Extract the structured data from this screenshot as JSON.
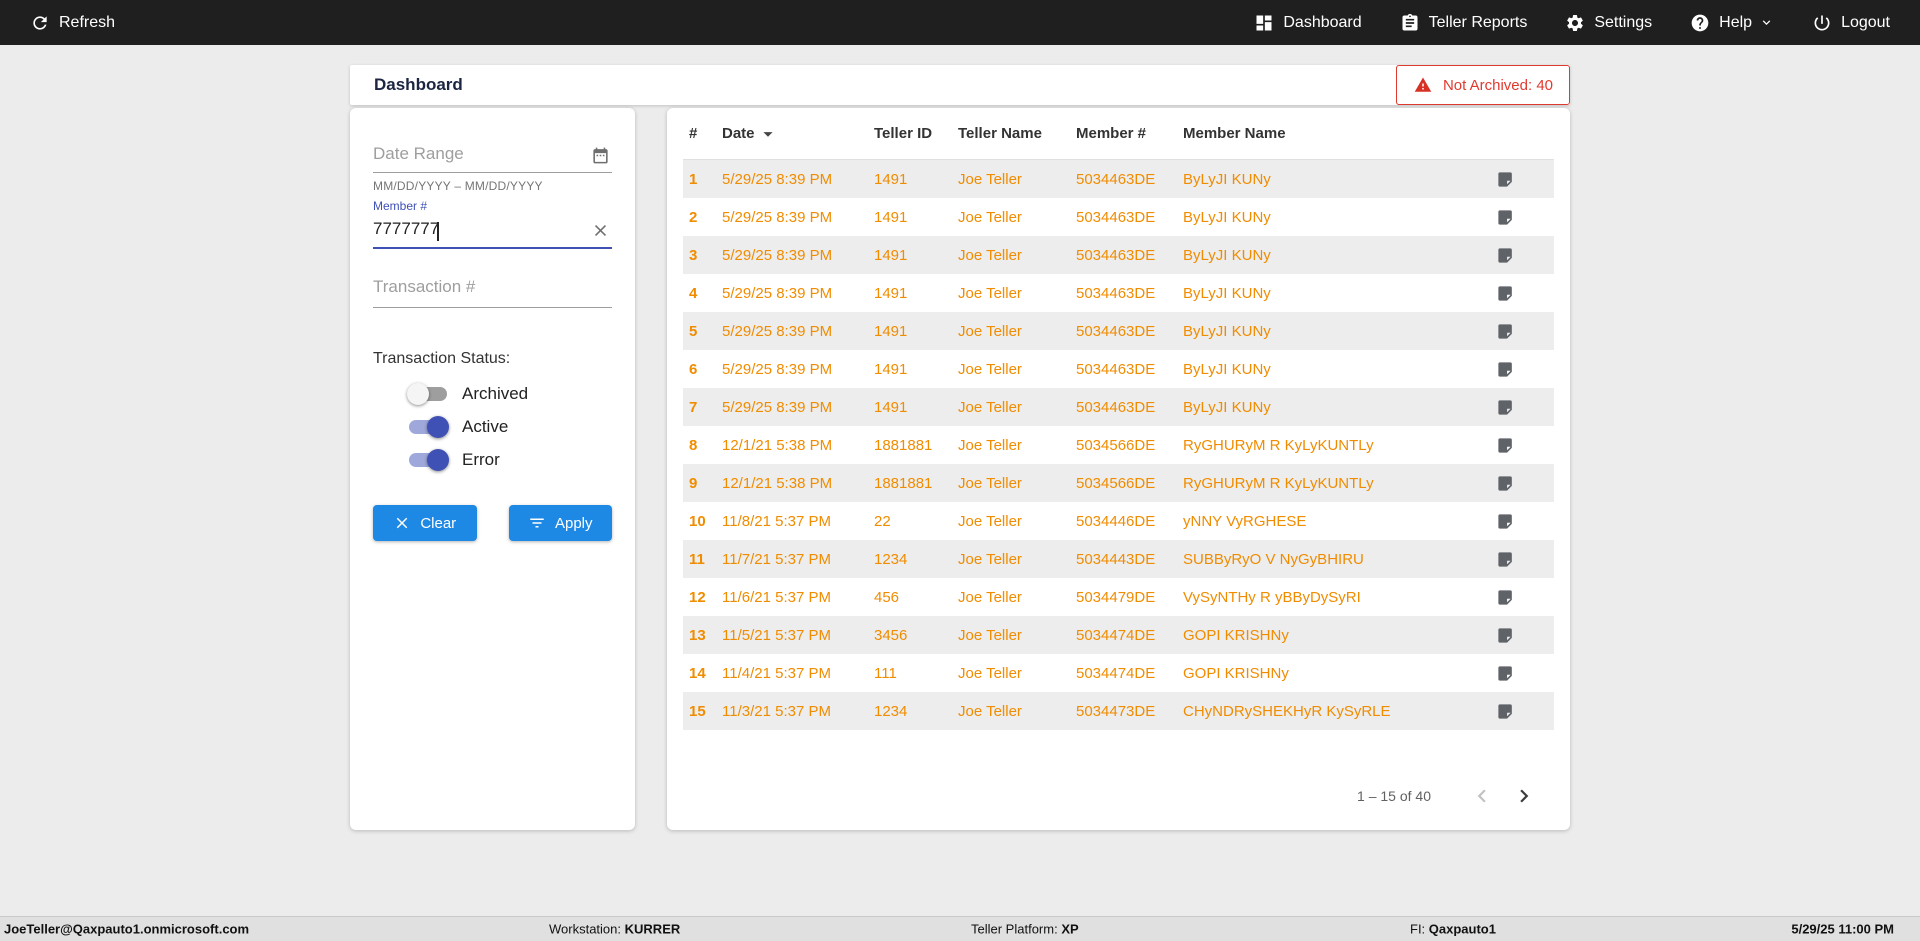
{
  "navbar": {
    "refresh_label": "Refresh",
    "items": [
      {
        "label": "Dashboard",
        "icon": "dashboard-grid-icon"
      },
      {
        "label": "Teller Reports",
        "icon": "clipboard-icon"
      },
      {
        "label": "Settings",
        "icon": "gear-icon"
      },
      {
        "label": "Help",
        "icon": "help-circle-icon"
      },
      {
        "label": "Logout",
        "icon": "power-icon"
      }
    ]
  },
  "header": {
    "title": "Dashboard",
    "badge": {
      "label": "Not Archived: 40",
      "icon": "warning-triangle-icon",
      "color": "#e03a2f"
    }
  },
  "filters": {
    "date_range": {
      "placeholder": "Date Range",
      "helper": "MM/DD/YYYY – MM/DD/YYYY",
      "icon": "calendar-icon"
    },
    "member": {
      "label": "Member #",
      "value": "7777777",
      "clear_icon": "close-icon"
    },
    "transaction": {
      "placeholder": "Transaction #"
    },
    "status_label": "Transaction Status:",
    "toggles": [
      {
        "label": "Archived",
        "on": false
      },
      {
        "label": "Active",
        "on": true
      },
      {
        "label": "Error",
        "on": true
      }
    ],
    "clear_label": "Clear",
    "apply_label": "Apply",
    "button_color": "#1e88e5",
    "toggle_color": "#3f51b5"
  },
  "table": {
    "columns": [
      "#",
      "Date",
      "Teller ID",
      "Teller Name",
      "Member #",
      "Member Name"
    ],
    "sorted_column": "Date",
    "sort_direction": "desc",
    "text_color": "#f08c00",
    "rows": [
      {
        "num": "1",
        "date": "5/29/25 8:39 PM",
        "teller_id": "1491",
        "teller_name": "Joe Teller",
        "member_num": "5034463DE",
        "member_name": "ByLyJI KUNy"
      },
      {
        "num": "2",
        "date": "5/29/25 8:39 PM",
        "teller_id": "1491",
        "teller_name": "Joe Teller",
        "member_num": "5034463DE",
        "member_name": "ByLyJI KUNy"
      },
      {
        "num": "3",
        "date": "5/29/25 8:39 PM",
        "teller_id": "1491",
        "teller_name": "Joe Teller",
        "member_num": "5034463DE",
        "member_name": "ByLyJI KUNy"
      },
      {
        "num": "4",
        "date": "5/29/25 8:39 PM",
        "teller_id": "1491",
        "teller_name": "Joe Teller",
        "member_num": "5034463DE",
        "member_name": "ByLyJI KUNy"
      },
      {
        "num": "5",
        "date": "5/29/25 8:39 PM",
        "teller_id": "1491",
        "teller_name": "Joe Teller",
        "member_num": "5034463DE",
        "member_name": "ByLyJI KUNy"
      },
      {
        "num": "6",
        "date": "5/29/25 8:39 PM",
        "teller_id": "1491",
        "teller_name": "Joe Teller",
        "member_num": "5034463DE",
        "member_name": "ByLyJI KUNy"
      },
      {
        "num": "7",
        "date": "5/29/25 8:39 PM",
        "teller_id": "1491",
        "teller_name": "Joe Teller",
        "member_num": "5034463DE",
        "member_name": "ByLyJI KUNy"
      },
      {
        "num": "8",
        "date": "12/1/21 5:38 PM",
        "teller_id": "1881881",
        "teller_name": "Joe Teller",
        "member_num": "5034566DE",
        "member_name": "RyGHURyM R KyLyKUNTLy"
      },
      {
        "num": "9",
        "date": "12/1/21 5:38 PM",
        "teller_id": "1881881",
        "teller_name": "Joe Teller",
        "member_num": "5034566DE",
        "member_name": "RyGHURyM R KyLyKUNTLy"
      },
      {
        "num": "10",
        "date": "11/8/21 5:37 PM",
        "teller_id": "22",
        "teller_name": "Joe Teller",
        "member_num": "5034446DE",
        "member_name": "yNNY VyRGHESE"
      },
      {
        "num": "11",
        "date": "11/7/21 5:37 PM",
        "teller_id": "1234",
        "teller_name": "Joe Teller",
        "member_num": "5034443DE",
        "member_name": "SUBByRyO V NyGyBHIRU"
      },
      {
        "num": "12",
        "date": "11/6/21 5:37 PM",
        "teller_id": "456",
        "teller_name": "Joe Teller",
        "member_num": "5034479DE",
        "member_name": "VySyNTHy R yBByDySyRI"
      },
      {
        "num": "13",
        "date": "11/5/21 5:37 PM",
        "teller_id": "3456",
        "teller_name": "Joe Teller",
        "member_num": "5034474DE",
        "member_name": "GOPI KRISHNy"
      },
      {
        "num": "14",
        "date": "11/4/21 5:37 PM",
        "teller_id": "111",
        "teller_name": "Joe Teller",
        "member_num": "5034474DE",
        "member_name": "GOPI KRISHNy"
      },
      {
        "num": "15",
        "date": "11/3/21 5:37 PM",
        "teller_id": "1234",
        "teller_name": "Joe Teller",
        "member_num": "5034473DE",
        "member_name": "CHyNDRySHEKHyR KySyRLE"
      }
    ],
    "pagination": {
      "range": "1 – 15 of 40"
    }
  },
  "statusbar": {
    "user": "JoeTeller@Qaxpauto1.onmicrosoft.com",
    "workstation_label": "Workstation:",
    "workstation": "KURRER",
    "platform_label": "Teller Platform:",
    "platform": "XP",
    "fi_label": "FI:",
    "fi": "Qaxpauto1",
    "datetime": "5/29/25 11:00 PM"
  }
}
